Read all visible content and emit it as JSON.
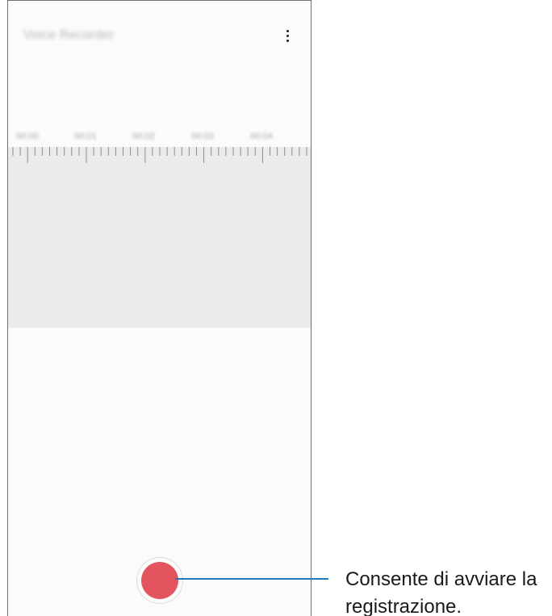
{
  "app": {
    "title": "Voice Recorder",
    "more_icon": "more-vertical-icon"
  },
  "timeline": {
    "labels": [
      "00:00",
      "00:01",
      "00:02",
      "00:03",
      "00:04"
    ]
  },
  "record_button": {
    "icon": "record-icon",
    "color": "#e4545f"
  },
  "callout": {
    "line_1": "Consente di avviare la",
    "line_2": "registrazione.",
    "line_color": "#1d7bb8"
  }
}
